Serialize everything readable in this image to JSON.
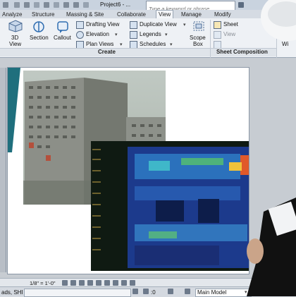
{
  "title_bar": {
    "project": "Project6 - ...",
    "search_placeholder": "Type a keyword or phrase"
  },
  "ribbon_tabs": [
    "Analyze",
    "Structure",
    "Massing & Site",
    "Collaborate",
    "View",
    "Manage",
    "Modify"
  ],
  "active_tab": "View",
  "ribbon": {
    "view_3d": "3D",
    "view_3d_sub": "View",
    "section": "Section",
    "callout": "Callout",
    "drafting_view": "Drafting View",
    "elevation": "Elevation",
    "plan_views": "Plan Views",
    "duplicate_view": "Duplicate View",
    "legends": "Legends",
    "schedules": "Schedules",
    "scope_box_1": "Scope",
    "scope_box_2": "Box",
    "sheet": "Sheet",
    "sheet_view": "View",
    "win": "Wi",
    "panel_create": "Create",
    "panel_sheet_composition": "Sheet Composition"
  },
  "status_bar": {
    "scale": "1/8\" = 1'-0\"",
    "left_text": "ads, SHI",
    "right_coord": ":0",
    "model": "Main Model"
  },
  "colors": {
    "accent": "#2f6db0",
    "ribbon_bg": "#eef1f5",
    "view_bg": "#ffffff",
    "thermal_dark": "#0f1a12"
  }
}
